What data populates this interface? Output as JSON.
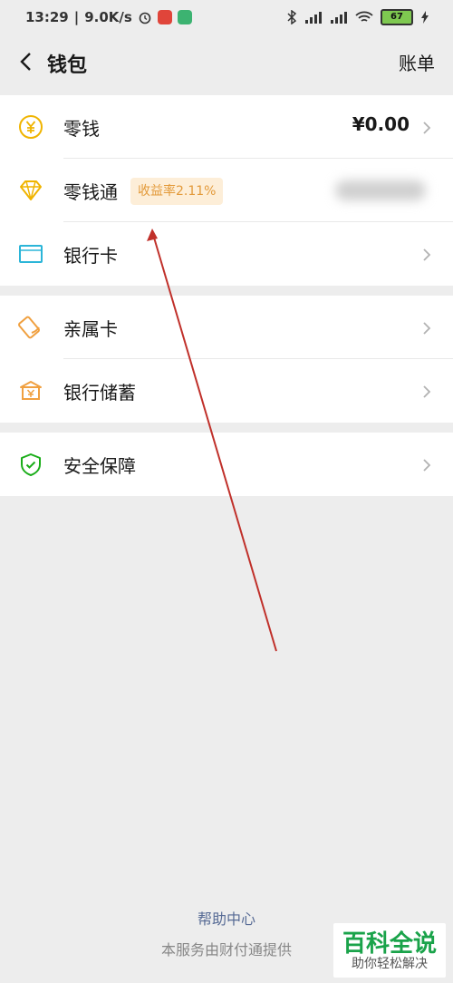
{
  "status": {
    "time": "13:29",
    "speed": "9.0K/s",
    "battery": "67"
  },
  "nav": {
    "title": "钱包",
    "right": "账单"
  },
  "group1": {
    "change": {
      "label": "零钱",
      "amount": "¥0.00"
    },
    "lingqiantong": {
      "label": "零钱通",
      "badge": "收益率2.11%"
    },
    "bankcard": {
      "label": "银行卡"
    }
  },
  "group2": {
    "family_card": {
      "label": "亲属卡"
    },
    "bank_savings": {
      "label": "银行储蓄"
    }
  },
  "group3": {
    "security": {
      "label": "安全保障"
    }
  },
  "footer": {
    "help": "帮助中心",
    "note": "本服务由财付通提供"
  },
  "watermark": {
    "title": "百科全说",
    "subtitle": "助你轻松解决"
  },
  "colors": {
    "background": "#ededed",
    "link": "#576b95",
    "badge_bg": "#fdeed8",
    "badge_text": "#e39a3a",
    "annotation_arrow": "#c0302a"
  }
}
